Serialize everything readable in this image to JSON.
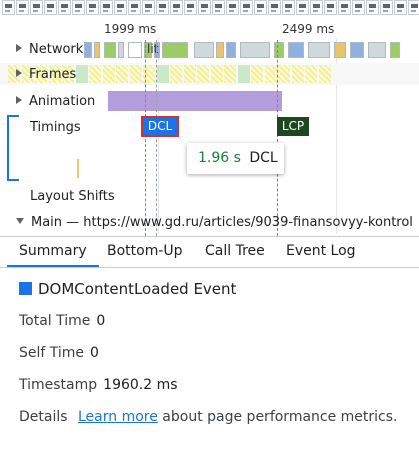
{
  "ruler": {
    "tick1": "1999 ms",
    "tick2": "2499 ms"
  },
  "tracks": {
    "network": {
      "label": "Network",
      "item_label": "lit"
    },
    "frames": {
      "label": "Frames"
    },
    "animation": {
      "label": "Animation"
    },
    "timings": {
      "label": "Timings",
      "dcl_marker": "DCL",
      "lcp_marker": "LCP"
    },
    "layout_shifts": {
      "label": "Layout Shifts"
    },
    "main": {
      "label": "Main — https://www.gd.ru/articles/9039-finansovyy-kontrol"
    }
  },
  "tooltip": {
    "time": "1.96 s",
    "name": "DCL"
  },
  "tabs": [
    "Summary",
    "Bottom-Up",
    "Call Tree",
    "Event Log"
  ],
  "active_tab": "Summary",
  "summary": {
    "title": "DOMContentLoaded Event",
    "total_time_label": "Total Time",
    "total_time_value": "0",
    "self_time_label": "Self Time",
    "self_time_value": "0",
    "timestamp_label": "Timestamp",
    "timestamp_value": "1960.2 ms",
    "details_label": "Details",
    "details_link": "Learn more",
    "details_suffix": "about page performance metrics."
  },
  "colors": {
    "dcl": "#1a73e8",
    "lcp": "#1e4620",
    "animation": "#b39ddb",
    "frames": "#e8e3a0",
    "accent": "#1a73e8"
  }
}
